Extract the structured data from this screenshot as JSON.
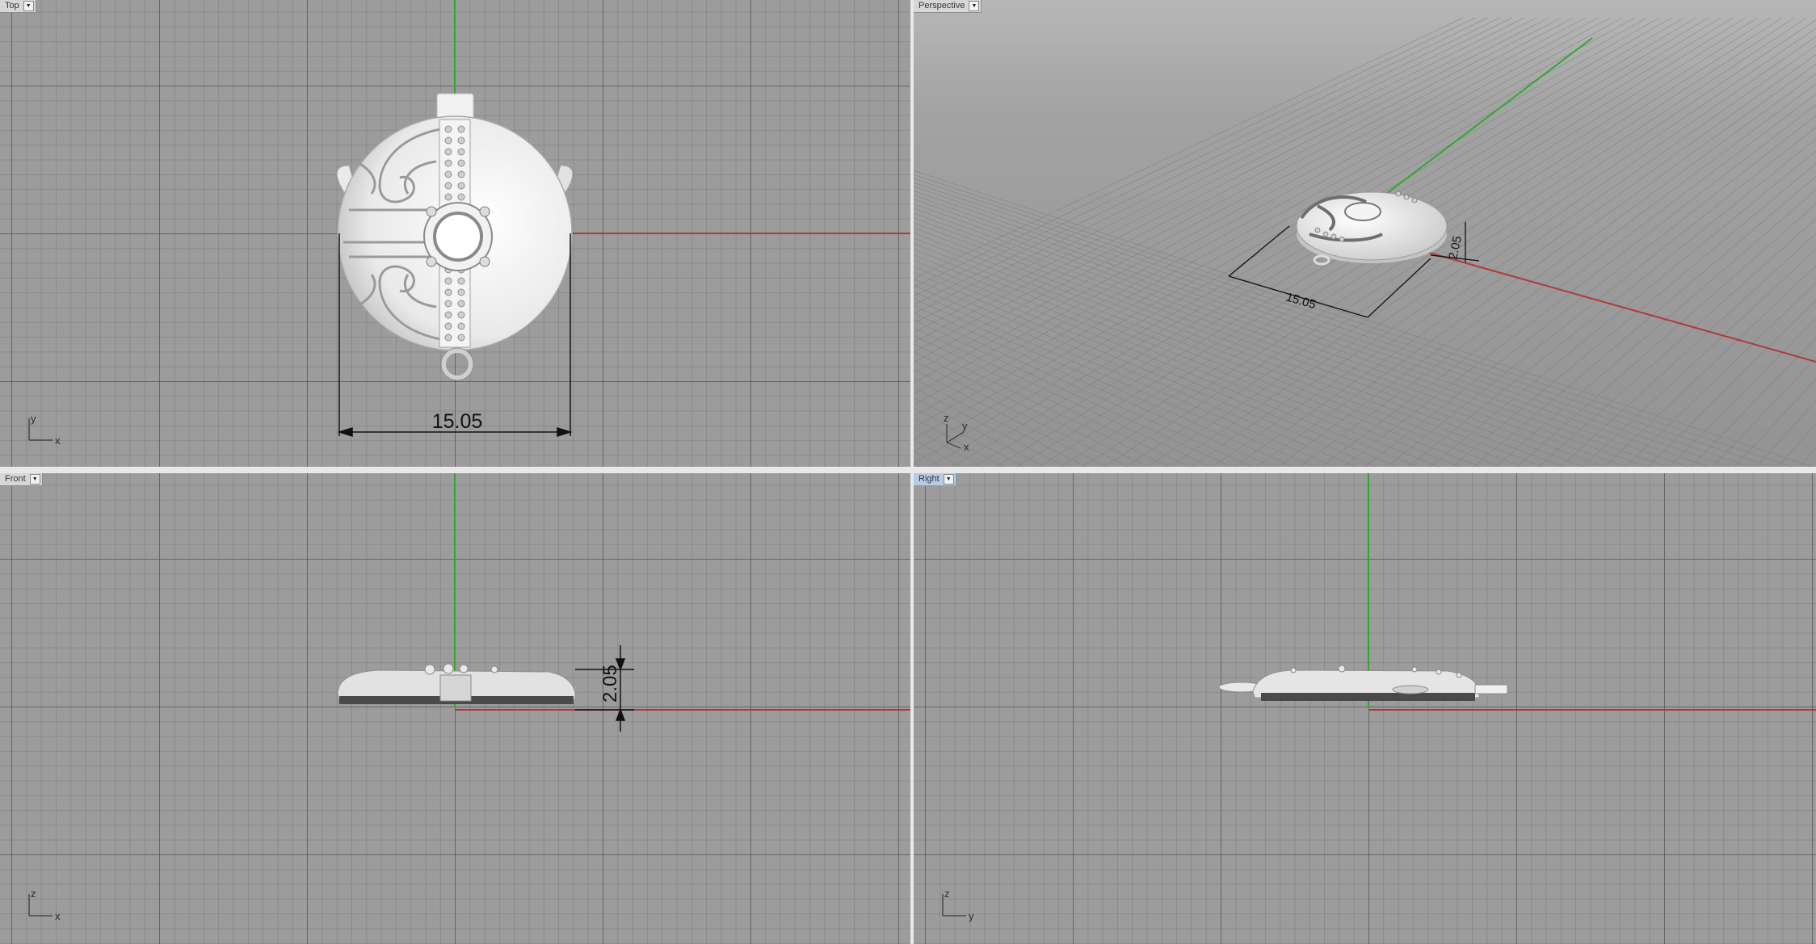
{
  "viewports": {
    "top": {
      "label": "Top",
      "dimension": "15.05",
      "axes": {
        "vertical": "y",
        "horizontal": "x"
      }
    },
    "perspective": {
      "label": "Perspective",
      "dimension_width": "15.05",
      "dimension_height": "2.05",
      "axes": {
        "z": "z",
        "y": "y",
        "x": "x"
      }
    },
    "front": {
      "label": "Front",
      "dimension": "2.05",
      "axes": {
        "vertical": "z",
        "horizontal": "x"
      }
    },
    "right": {
      "label": "Right",
      "axes": {
        "vertical": "z",
        "horizontal": "y"
      }
    }
  },
  "icons": {
    "dropdown": "triangle-down-icon"
  },
  "colors": {
    "viewport_background": "#9c9c9c",
    "x_axis": "#b03a3a",
    "y_axis": "#2fa82f",
    "active_tab": "#b6cce6",
    "model": "#e6e6e6"
  }
}
